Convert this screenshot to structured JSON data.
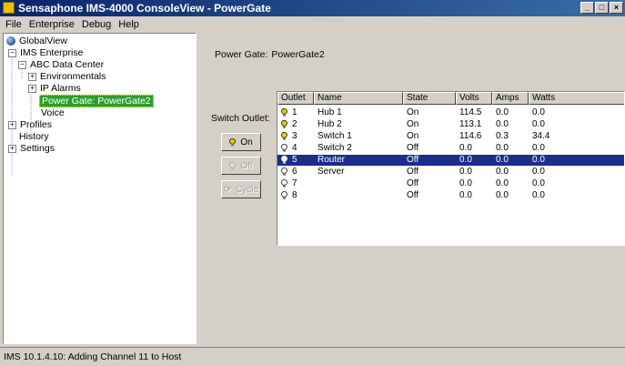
{
  "window": {
    "title": "Sensaphone IMS-4000 ConsoleView - PowerGate",
    "controls": [
      "_",
      "□",
      "×"
    ]
  },
  "menu": [
    "File",
    "Enterprise",
    "Debug",
    "Help"
  ],
  "tree": {
    "globalview": "GlobalView",
    "enterprise": "IMS Enterprise",
    "datacenter": "ABC Data Center",
    "environmentals": "Environmentals",
    "ipalarms": "IP Alarms",
    "powergate": "Power Gate: PowerGate2",
    "voice": "Voice",
    "profiles": "Profiles",
    "history": "History",
    "settings": "Settings"
  },
  "main": {
    "pg_label": "Power Gate:",
    "pg_value": "PowerGate2",
    "switch_label": "Switch Outlet:",
    "btn_on": "On",
    "btn_off": "Off",
    "btn_cycle": "Cycle"
  },
  "table": {
    "columns": [
      "Outlet",
      "Name",
      "State",
      "Volts",
      "Amps",
      "Watts"
    ],
    "rows": [
      {
        "outlet": "1",
        "name": "Hub 1",
        "state": "On",
        "volts": "114.5",
        "amps": "0.0",
        "watts": "0.0",
        "lit": true
      },
      {
        "outlet": "2",
        "name": "Hub 2",
        "state": "On",
        "volts": "113.1",
        "amps": "0.0",
        "watts": "0.0",
        "lit": true
      },
      {
        "outlet": "3",
        "name": "Switch 1",
        "state": "On",
        "volts": "114.6",
        "amps": "0.3",
        "watts": "34.4",
        "lit": true
      },
      {
        "outlet": "4",
        "name": "Switch 2",
        "state": "Off",
        "volts": "0.0",
        "amps": "0.0",
        "watts": "0.0",
        "lit": false
      },
      {
        "outlet": "5",
        "name": "Router",
        "state": "Off",
        "volts": "0.0",
        "amps": "0.0",
        "watts": "0.0",
        "lit": false,
        "selected": true
      },
      {
        "outlet": "6",
        "name": "Server",
        "state": "Off",
        "volts": "0.0",
        "amps": "0.0",
        "watts": "0.0",
        "lit": false
      },
      {
        "outlet": "7",
        "name": "",
        "state": "Off",
        "volts": "0.0",
        "amps": "0.0",
        "watts": "0.0",
        "lit": false
      },
      {
        "outlet": "8",
        "name": "",
        "state": "Off",
        "volts": "0.0",
        "amps": "0.0",
        "watts": "0.0",
        "lit": false
      }
    ]
  },
  "status": "IMS 10.1.4.10: Adding Channel 11 to Host",
  "colors": {
    "bulb_on": "#e8c800",
    "bulb_off": "#ffffff",
    "selection": "#1c2d8c",
    "tree_selection": "#2d9e2d"
  }
}
